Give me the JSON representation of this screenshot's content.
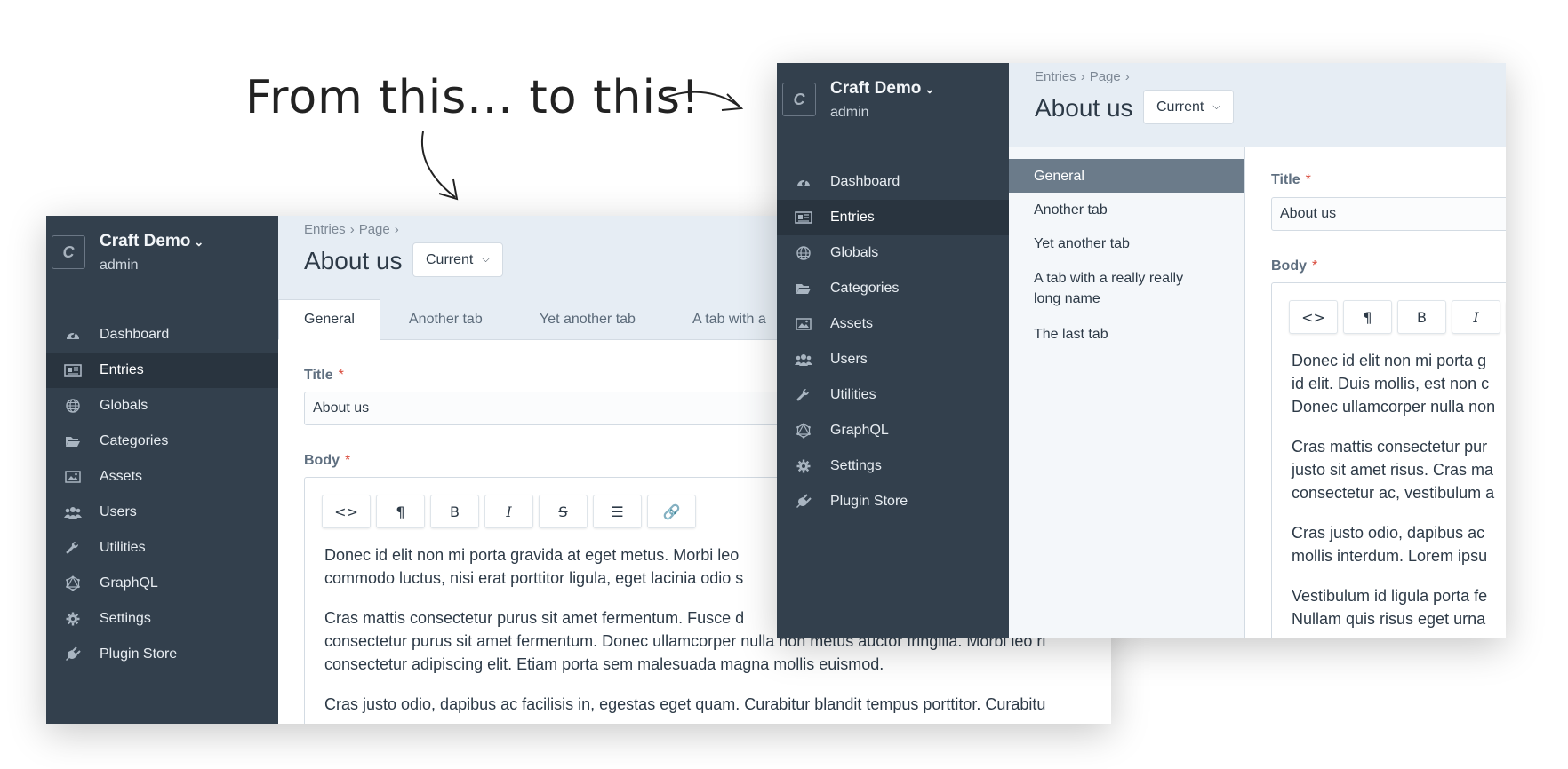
{
  "headline": "From this... to this!",
  "app": {
    "site_name": "Craft Demo",
    "user": "admin",
    "logo_letter": "C",
    "chevron": "⌄"
  },
  "nav": [
    {
      "label": "Dashboard",
      "icon": "dashboard-icon"
    },
    {
      "label": "Entries",
      "icon": "entries-icon",
      "active": true
    },
    {
      "label": "Globals",
      "icon": "globe-icon"
    },
    {
      "label": "Categories",
      "icon": "folder-icon"
    },
    {
      "label": "Assets",
      "icon": "image-icon"
    },
    {
      "label": "Users",
      "icon": "users-icon"
    },
    {
      "label": "Utilities",
      "icon": "wrench-icon"
    },
    {
      "label": "GraphQL",
      "icon": "graphql-icon"
    },
    {
      "label": "Settings",
      "icon": "gear-icon"
    },
    {
      "label": "Plugin Store",
      "icon": "plug-icon"
    }
  ],
  "breadcrumb": [
    "Entries",
    "Page"
  ],
  "breadcrumb_sep": "›",
  "page_title": "About us",
  "revision": "Current",
  "tabs": [
    "General",
    "Another tab",
    "Yet another tab",
    "A tab with a really really long name",
    "The last tab"
  ],
  "tabs_left_visible": [
    "General",
    "Another tab",
    "Yet another tab",
    "A tab with a"
  ],
  "fields": {
    "title_label": "Title",
    "title_value": "About us",
    "body_label": "Body",
    "required_mark": "*"
  },
  "toolbar": [
    "<>",
    "¶",
    "B",
    "I",
    "S",
    "list",
    "link"
  ],
  "body_left": [
    [
      "Donec id elit non mi porta gravida at eget metus. Morbi leo",
      "commodo luctus, nisi erat porttitor ligula, eget lacinia odio s"
    ],
    [
      "Cras mattis consectetur purus sit amet fermentum. Fusce d",
      "consectetur purus sit amet fermentum. Donec ullamcorper nulla non metus auctor fringilla. Morbi leo ri",
      "consectetur adipiscing elit. Etiam porta sem malesuada magna mollis euismod."
    ],
    [
      "Cras justo odio, dapibus ac facilisis in, egestas eget quam. Curabitur blandit tempus porttitor. Curabitu"
    ]
  ],
  "body_right": [
    [
      "Donec id elit non mi porta g",
      "id elit. Duis mollis, est non c",
      "Donec ullamcorper nulla non"
    ],
    [
      "Cras mattis consectetur pur",
      "justo sit amet risus. Cras ma",
      "consectetur ac, vestibulum a"
    ],
    [
      "Cras justo odio, dapibus ac",
      "mollis interdum. Lorem ipsu"
    ],
    [
      "Vestibulum id ligula porta fe",
      "Nullam quis risus eget urna"
    ]
  ],
  "colors": {
    "sidebar": "#33404d",
    "sidebar_active": "#29343f",
    "header": "#e6edf4",
    "tab_active_vertical": "#6b7b8a",
    "required": "#d94a3b"
  }
}
